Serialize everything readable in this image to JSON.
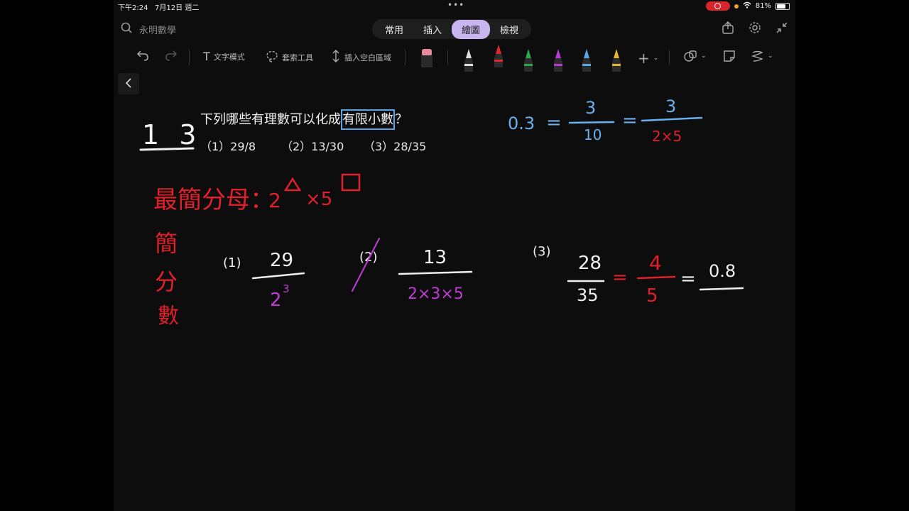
{
  "status": {
    "time": "下午2:24",
    "date": "7月12日 週二",
    "battery": "81%"
  },
  "search": {
    "title": "永明數學"
  },
  "tabs": [
    {
      "label": "常用",
      "active": false
    },
    {
      "label": "插入",
      "active": false
    },
    {
      "label": "繪圖",
      "active": true
    },
    {
      "label": "檢視",
      "active": false
    }
  ],
  "toolbar": {
    "text_mode": "文字模式",
    "lasso": "套索工具",
    "insert_space": "插入空白區域",
    "pens": [
      {
        "name": "black-pen",
        "color": "#dddddd"
      },
      {
        "name": "red-pen",
        "color": "#e0262e"
      },
      {
        "name": "green-pen",
        "color": "#2aa84a"
      },
      {
        "name": "purple-pen",
        "color": "#b43bd6"
      },
      {
        "name": "blue-pen",
        "color": "#5aa6e6"
      },
      {
        "name": "yellow-pen",
        "color": "#e3b436"
      }
    ]
  },
  "note": {
    "problem_number": "1 3",
    "question_before": "下列哪些有理數可以化成",
    "question_boxed": "有限小數",
    "question_after": "？",
    "options": [
      "（1）29/8",
      "（2）13/30",
      "（3）28/35"
    ],
    "colors": {
      "white": "#f0f0f0",
      "red": "#e0202a",
      "blue": "#6ab0ee",
      "purple": "#c03bd8"
    },
    "handwriting": {
      "example_lhs": "0.3",
      "eq": "=",
      "example_num1": "3",
      "example_den1": "10",
      "example_num2": "3",
      "example_den2": "2×5",
      "rule_label": "最簡分母：",
      "rule_expr_2": "2",
      "rule_expr_x5": "×5",
      "side_chars": [
        "簡",
        "分",
        "數"
      ],
      "item1_label": "(1)",
      "item1_num": "29",
      "item1_den_base": "2",
      "item1_den_exp": "3",
      "item2_label": "(2)",
      "item2_num": "13",
      "item2_den": "2×3×5",
      "item3_label": "(3)",
      "item3_num": "28",
      "item3_den": "35",
      "item3_num2": "4",
      "item3_den2": "5",
      "item3_result": "0.8"
    }
  }
}
